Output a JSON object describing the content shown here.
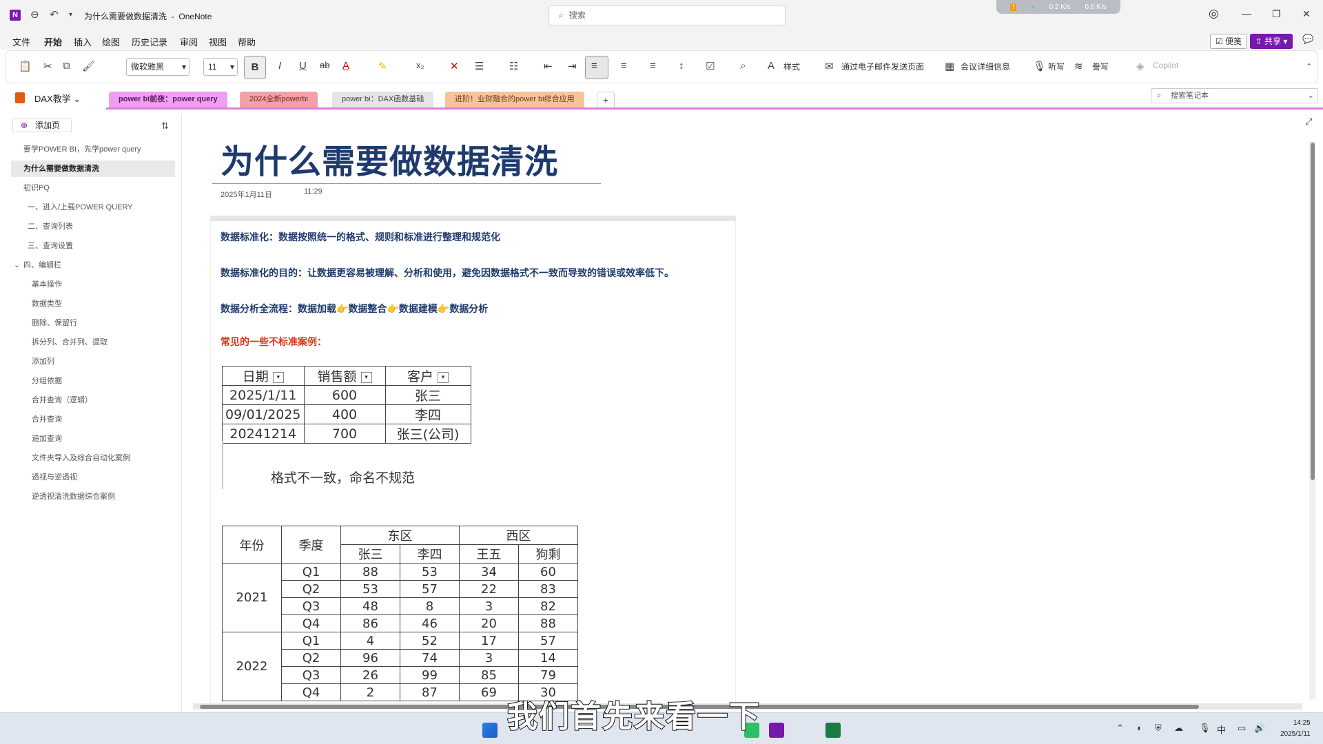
{
  "window": {
    "title": "为什么需要做数据清洗",
    "app": "OneNote",
    "search_placeholder": "搜索"
  },
  "net": {
    "up": "0.2 K/s",
    "down": "0.0 K/s"
  },
  "menus": [
    "文件",
    "开始",
    "插入",
    "绘图",
    "历史记录",
    "审阅",
    "视图",
    "帮助"
  ],
  "ribbon": {
    "font": "微软雅黑",
    "size": "11",
    "styles": "样式",
    "email": "通过电子邮件发送页面",
    "meeting": "会议详细信息",
    "dictate": "听写",
    "read": "誊写",
    "copilot": "Copilot",
    "jian": "便笺",
    "share": "共享"
  },
  "notebook": {
    "name": "DAX教学",
    "tabs": [
      "power bi前夜：power query",
      "2024全新powerbi",
      "power bi：DAX函数基础",
      "进阶！业财融合的power bi综合应用"
    ],
    "add": "+",
    "search_placeholder": "搜索笔记本"
  },
  "sidebar": {
    "add_page": "添加页",
    "pages": [
      {
        "label": "要学POWER BI，先学power query",
        "indent": 0
      },
      {
        "label": "为什么需要做数据清洗",
        "indent": 0,
        "selected": true
      },
      {
        "label": "初识PQ",
        "indent": 0
      },
      {
        "label": "一、进入/上载POWER QUERY",
        "indent": 1
      },
      {
        "label": "二、查询列表",
        "indent": 1
      },
      {
        "label": "三、查询设置",
        "indent": 1
      },
      {
        "label": "四、编辑栏",
        "indent": 0,
        "expander": "⌄"
      },
      {
        "label": "基本操作",
        "indent": 2
      },
      {
        "label": "数据类型",
        "indent": 2
      },
      {
        "label": "删除、保留行",
        "indent": 2
      },
      {
        "label": "拆分列、合并列、提取",
        "indent": 2
      },
      {
        "label": "添加列",
        "indent": 2
      },
      {
        "label": "分组依据",
        "indent": 2
      },
      {
        "label": "合并查询（逻辑）",
        "indent": 2
      },
      {
        "label": "合并查询",
        "indent": 2
      },
      {
        "label": "追加查询",
        "indent": 2
      },
      {
        "label": "文件夹导入及综合自动化案例",
        "indent": 2
      },
      {
        "label": "透视与逆透视",
        "indent": 2
      },
      {
        "label": "逆透视清洗数据综合案例",
        "indent": 2
      }
    ]
  },
  "page": {
    "title": "为什么需要做数据清洗",
    "date": "2025年1月11日",
    "time": "11:29",
    "lines": {
      "l1": "数据标准化：数据按照统一的格式、规则和标准进行整理和规范化",
      "l2": "数据标准化的目的：让数据更容易被理解、分析和使用，避免因数据格式不一致而导致的错误或效率低下。",
      "l3a": "数据分析全流程：数据加载",
      "l3b": "数据整合",
      "l3c": "数据建模",
      "l3d": "数据分析",
      "emoji": "👉",
      "l4": "常见的一些不标准案例："
    },
    "table1": {
      "headers": [
        "日期",
        "销售额",
        "客户"
      ],
      "rows": [
        [
          "2025/1/11",
          "600",
          "张三"
        ],
        [
          "09/01/2025",
          "400",
          "李四"
        ],
        [
          "20241214",
          "700",
          "张三(公司)"
        ]
      ],
      "note": "格式不一致，命名不规范"
    },
    "table2": {
      "h_year": "年份",
      "h_quarter": "季度",
      "h_east": "东区",
      "h_west": "西区",
      "names": [
        "张三",
        "李四",
        "王五",
        "狗剩"
      ],
      "years": [
        {
          "year": "2021",
          "rows": [
            [
              "Q1",
              "88",
              "53",
              "34",
              "60"
            ],
            [
              "Q2",
              "53",
              "57",
              "22",
              "83"
            ],
            [
              "Q3",
              "48",
              "8",
              "3",
              "82"
            ],
            [
              "Q4",
              "86",
              "46",
              "20",
              "88"
            ]
          ]
        },
        {
          "year": "2022",
          "rows": [
            [
              "Q1",
              "4",
              "52",
              "17",
              "57"
            ],
            [
              "Q2",
              "96",
              "74",
              "3",
              "14"
            ],
            [
              "Q3",
              "26",
              "99",
              "85",
              "79"
            ],
            [
              "Q4",
              "2",
              "87",
              "69",
              "30"
            ]
          ]
        }
      ]
    }
  },
  "subtitle": "我们首先来看一下",
  "clock": {
    "time": "14:25",
    "date": "2025/1/11"
  },
  "taskbar_ime": "中"
}
